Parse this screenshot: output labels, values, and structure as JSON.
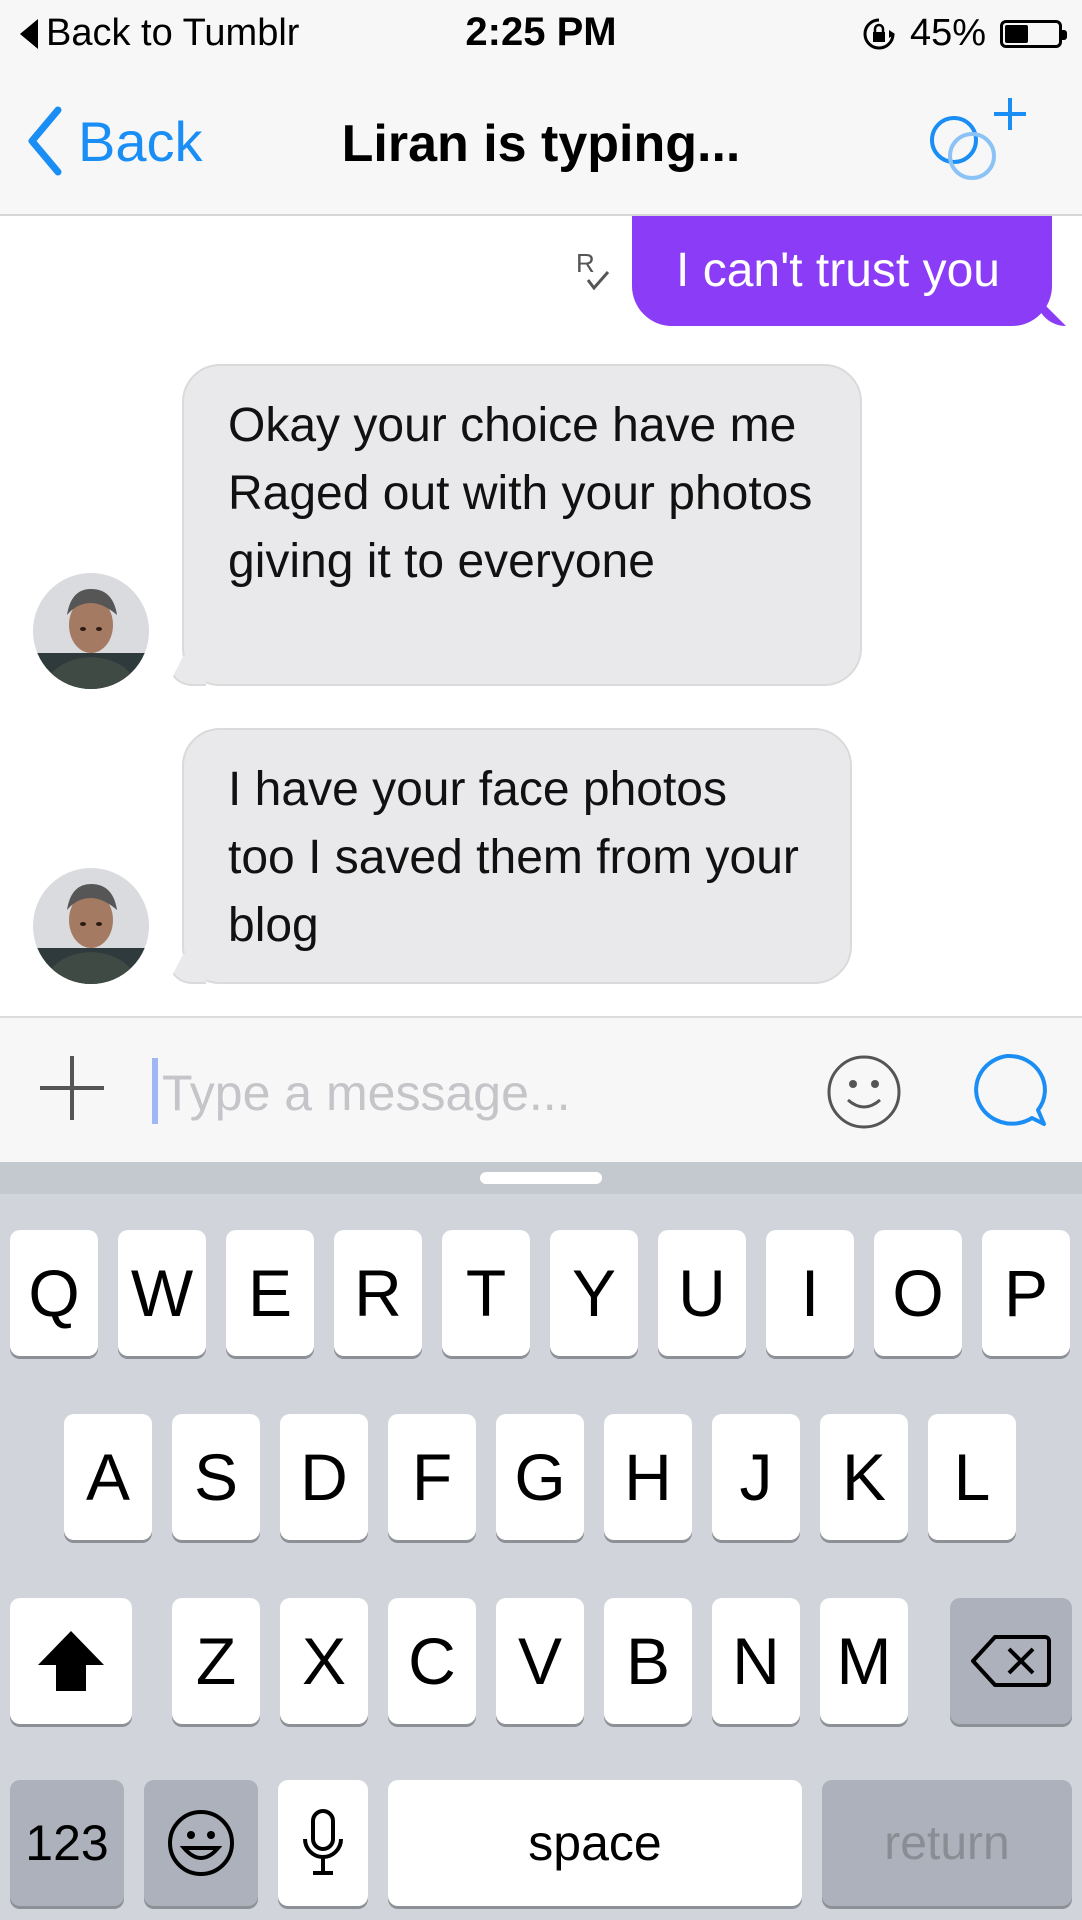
{
  "status_bar": {
    "back_app": "Back to Tumblr",
    "time": "2:25 PM",
    "battery": "45%",
    "battery_level": 0.45
  },
  "nav": {
    "back_label": "Back",
    "title": "Liran is typing..."
  },
  "messages": [
    {
      "direction": "out",
      "text": "I can't trust you"
    },
    {
      "direction": "in",
      "text": "Okay your choice have me Raged out with your photos giving it to everyone"
    },
    {
      "direction": "in",
      "text": "I have your face photos too I saved them from your blog"
    }
  ],
  "composer": {
    "placeholder": "Type a message..."
  },
  "keyboard": {
    "row1": [
      "Q",
      "W",
      "E",
      "R",
      "T",
      "Y",
      "U",
      "I",
      "O",
      "P"
    ],
    "row2": [
      "A",
      "S",
      "D",
      "F",
      "G",
      "H",
      "J",
      "K",
      "L"
    ],
    "row3": [
      "Z",
      "X",
      "C",
      "V",
      "B",
      "N",
      "M"
    ],
    "numbers": "123",
    "space": "space",
    "return": "return"
  },
  "colors": {
    "accent": "#1a8ef5",
    "outgoing_bubble": "#8b3cf6",
    "incoming_bubble": "#e9e9eb"
  }
}
